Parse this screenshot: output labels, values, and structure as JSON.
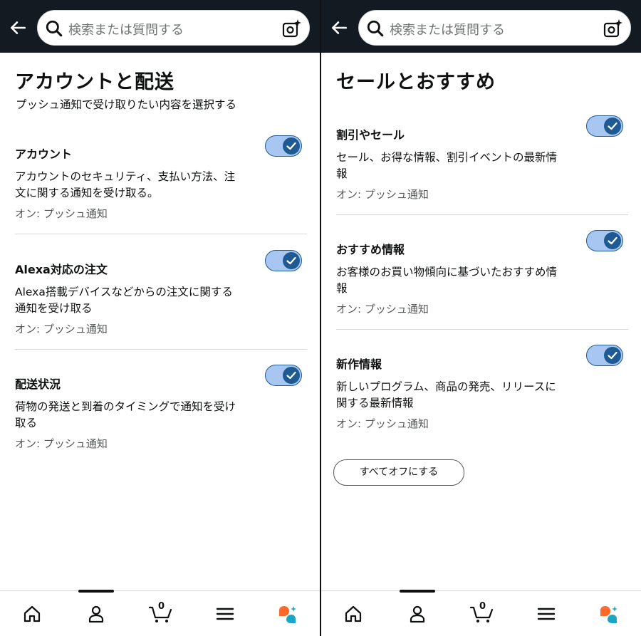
{
  "search": {
    "placeholder": "検索または質問する"
  },
  "left": {
    "title": "アカウントと配送",
    "subtitle": "プッシュ通知で受け取りたい内容を選択する",
    "items": [
      {
        "title": "アカウント",
        "description": "アカウントのセキュリティ、支払い方法、注文に関する通知を受け取る。",
        "status": "オン: プッシュ通知",
        "enabled": true
      },
      {
        "title": "Alexa対応の注文",
        "description": "Alexa搭載デバイスなどからの注文に関する通知を受け取る",
        "status": "オン: プッシュ通知",
        "enabled": true
      },
      {
        "title": "配送状況",
        "description": "荷物の発送と到着のタイミングで通知を受け取る",
        "status": "オン: プッシュ通知",
        "enabled": true
      }
    ]
  },
  "right": {
    "title": "セールとおすすめ",
    "items": [
      {
        "title": "割引やセール",
        "description": "セール、お得な情報、割引イベントの最新情報",
        "status": "オン: プッシュ通知",
        "enabled": true
      },
      {
        "title": "おすすめ情報",
        "description": "お客様のお買い物傾向に基づいたおすすめ情報",
        "status": "オン: プッシュ通知",
        "enabled": true
      },
      {
        "title": "新作情報",
        "description": "新しいプログラム、商品の発売、リリースに関する最新情報",
        "status": "オン: プッシュ通知",
        "enabled": true
      }
    ],
    "turn_off_all": "すべてオフにする"
  },
  "bottom_nav": {
    "cart_count": "0",
    "icons": [
      "home-icon",
      "account-icon",
      "cart-icon",
      "menu-icon",
      "ai-assistant-icon"
    ]
  },
  "colors": {
    "topbar": "#131a22",
    "toggle_on": "#1f5a92",
    "toggle_track": "#a7c6f1",
    "assistant_orange": "#ff6a2a",
    "assistant_teal": "#1ca5c5"
  }
}
